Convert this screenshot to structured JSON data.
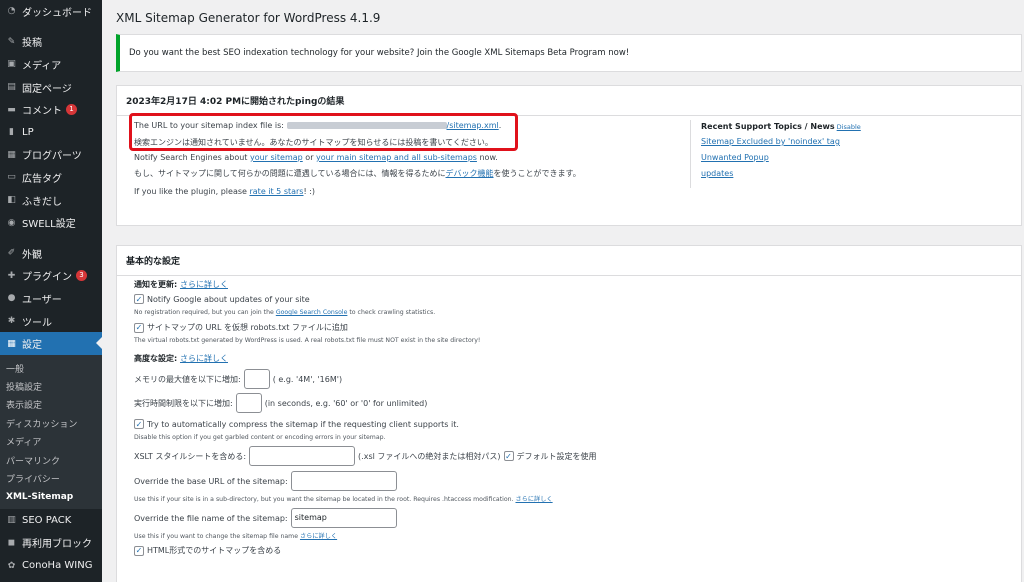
{
  "sidebar": {
    "items_top": [
      {
        "label": "ダッシュボード",
        "icon": "dashboard-icon"
      },
      {
        "sep": true
      },
      {
        "label": "投稿",
        "icon": "pin-icon"
      },
      {
        "label": "メディア",
        "icon": "media-icon"
      },
      {
        "label": "固定ページ",
        "icon": "page-icon"
      },
      {
        "label": "コメント",
        "icon": "comment-icon",
        "badge": "1"
      },
      {
        "label": "LP",
        "icon": "lp-icon"
      },
      {
        "label": "ブログパーツ",
        "icon": "blogparts-icon"
      },
      {
        "label": "広告タグ",
        "icon": "adtag-icon"
      },
      {
        "label": "ふきだし",
        "icon": "balloon-icon"
      },
      {
        "label": "SWELL設定",
        "icon": "swell-icon"
      },
      {
        "sep": true
      },
      {
        "label": "外観",
        "icon": "appearance-icon"
      },
      {
        "label": "プラグイン",
        "icon": "plugin-icon",
        "badge": "3"
      },
      {
        "label": "ユーザー",
        "icon": "user-icon"
      },
      {
        "label": "ツール",
        "icon": "tools-icon"
      },
      {
        "label": "設定",
        "icon": "settings-icon",
        "current": true
      }
    ],
    "submenu": [
      {
        "label": "一般"
      },
      {
        "label": "投稿設定"
      },
      {
        "label": "表示設定"
      },
      {
        "label": "ディスカッション"
      },
      {
        "label": "メディア"
      },
      {
        "label": "パーマリンク"
      },
      {
        "label": "プライバシー"
      },
      {
        "label": "XML-Sitemap",
        "current": true
      }
    ],
    "items_bottom": [
      {
        "label": "SEO PACK",
        "icon": "seopack-icon"
      },
      {
        "label": "再利用ブロック",
        "icon": "reuse-icon"
      },
      {
        "label": "ConoHa WING",
        "icon": "conoha-icon"
      }
    ]
  },
  "page": {
    "title": "XML Sitemap Generator for WordPress 4.1.9",
    "notice": "Do you want the best SEO indexation technology for your website? Join the Google XML Sitemaps Beta Program now!"
  },
  "ping": {
    "heading": "2023年2月17日 4:02 PMに開始されたpingの結果",
    "url_prefix": "The URL to your sitemap index file is: ",
    "url_suffix": "/sitemap.xml",
    "url_end": ".",
    "not_notified": "検索エンジンは通知されていません。あなたのサイトマップを知らせるには投稿を書いてください。",
    "notify_pre": "Notify Search Engines about ",
    "notify_link1": "your sitemap",
    "notify_mid": " or ",
    "notify_link2": "your main sitemap and all sub-sitemaps",
    "notify_post": " now.",
    "debug_pre": "もし、サイトマップに関して何らかの問題に遭遇している場合には、情報を得るために",
    "debug_link": "デバック機能",
    "debug_post": "を使うことができます。",
    "rate_pre": "If you like the plugin, please ",
    "rate_link": "rate it 5 stars",
    "rate_post": "! :)",
    "support_title": "Recent Support Topics / News",
    "support_disable": "Disable",
    "support_links": [
      "Sitemap Excluded by 'noindex' tag",
      "Unwanted Popup",
      "updates"
    ]
  },
  "settings": {
    "heading": "基本的な設定",
    "notify_label": "通知を更新: ",
    "more_link": "さらに詳しく",
    "notify_google": "Notify Google about updates of your site",
    "notify_google_help_pre": "No registration required, but you can join the ",
    "notify_google_help_link": "Google Search Console",
    "notify_google_help_post": " to check crawling statistics.",
    "robots": "サイトマップの URL を仮想 robots.txt ファイルに追加",
    "robots_help": "The virtual robots.txt generated by WordPress is used. A real robots.txt file must NOT exist in the site directory!",
    "advanced_label": "高度な設定: ",
    "memory_label": "メモリの最大値を以下に増加:",
    "memory_hint": "( e.g. '4M', '16M')",
    "time_label": "実行時間制限を以下に増加:",
    "time_hint": "(in seconds, e.g. '60' or '0' for unlimited)",
    "compress": "Try to automatically compress the sitemap if the requesting client supports it.",
    "compress_help": "Disable this option if you get garbled content or encoding errors in your sitemap.",
    "xslt_label": "XSLT スタイルシートを含める:",
    "xslt_hint": "(.xsl ファイルへの絶対または相対パス)",
    "xslt_default": "デフォルト設定を使用",
    "baseurl_label": "Override the base URL of the sitemap:",
    "baseurl_help": "Use this if your site is in a sub-directory, but you want the sitemap be located in the root. Requires .htaccess modification. ",
    "filename_label": "Override the file name of the sitemap:",
    "filename_value": "sitemap",
    "filename_help": "Use this if you want to change the sitemap file name ",
    "html_sitemap": "HTML形式でのサイトマップを含める"
  }
}
